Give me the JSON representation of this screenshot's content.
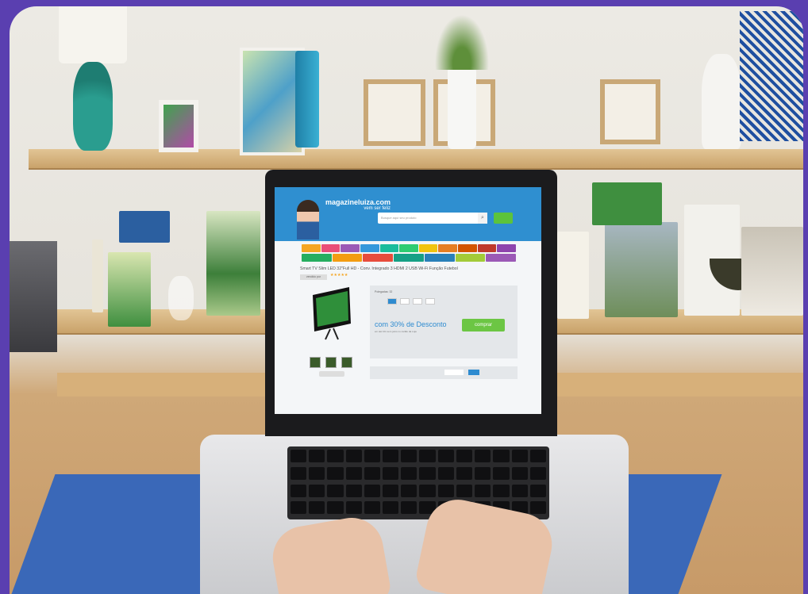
{
  "site": {
    "logo": "magazineluiza.com",
    "logo_tagline": "vem ser feliz",
    "search_placeholder": "Busque aqui seu produto",
    "product_title": "Smart TV Slim LED 32\"Full HD - Conv. Integrado 3 HDMI 2 USB Wi-Fi Função Futebol",
    "seller_badge": "vendido por",
    "rating_stars": "★★★★★",
    "discount_text": "com 30% de Desconto",
    "discount_sub": "em até 10x sem juros no cartão da Loja",
    "buy_label": "comprar",
    "size_label": "Polegadas: 32",
    "cart_icon": "cart-icon",
    "search_icon": "search-icon"
  },
  "colors": {
    "frame": "#5a3fb0",
    "header": "#2f8fd0",
    "buy": "#6cc644",
    "accent": "#2e8bd0"
  }
}
